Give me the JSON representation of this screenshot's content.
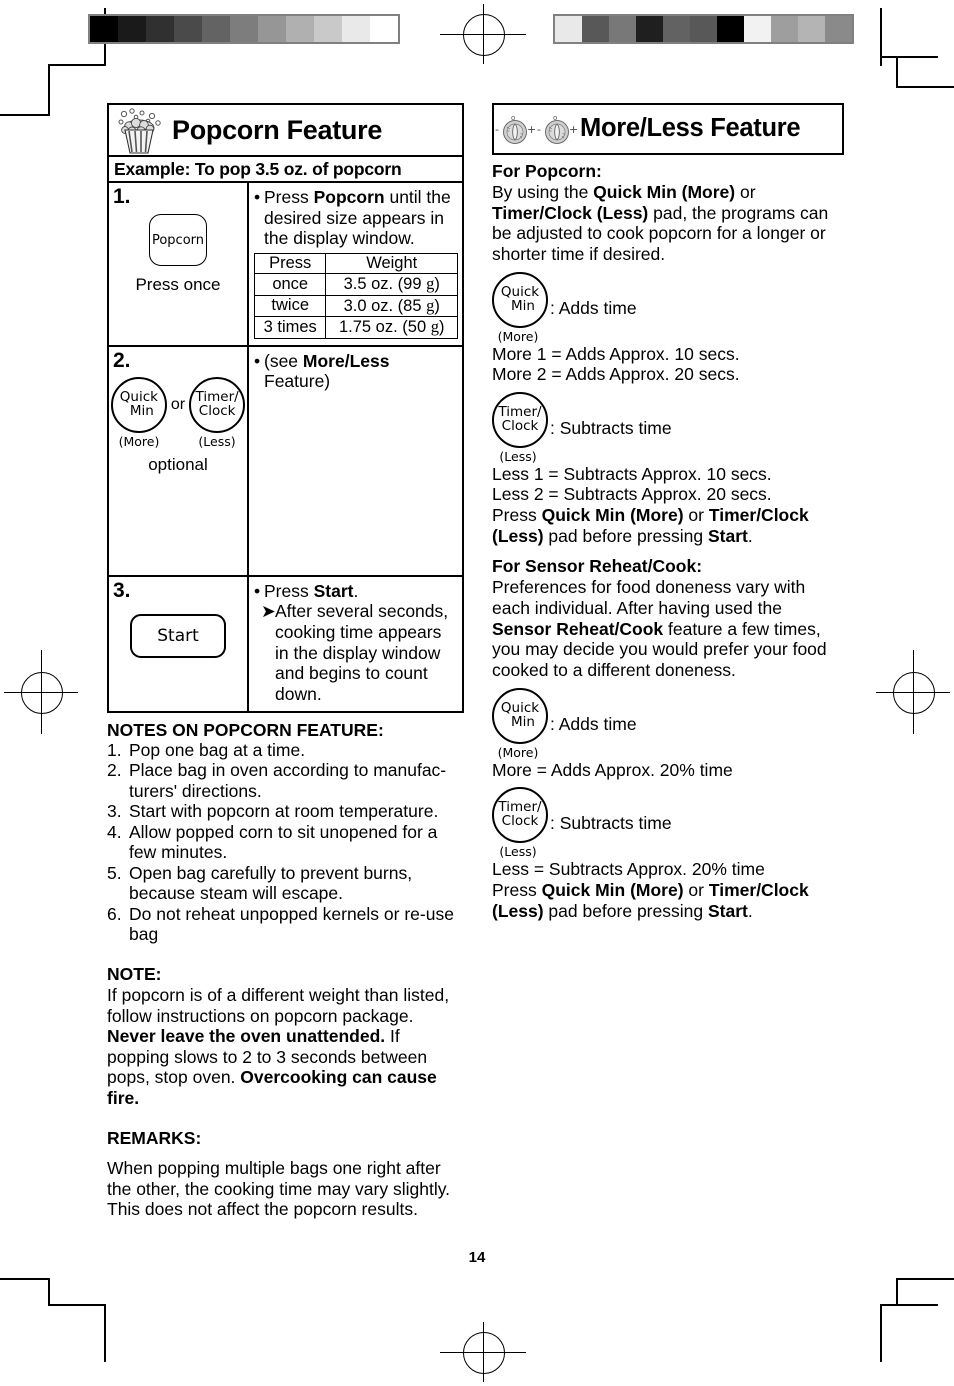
{
  "page": {
    "number": "14"
  },
  "marks": {
    "grey_bar_left": [
      "#000000",
      "#1a1a1a",
      "#303030",
      "#4a4a4a",
      "#636363",
      "#7d7d7d",
      "#969696",
      "#b0b0b0",
      "#c9c9c9",
      "#e9e9e9",
      "#ffffff"
    ],
    "grey_bar_right": [
      "#e9e9e9",
      "#585858",
      "#787878",
      "#1f1f1f",
      "#626262",
      "#585858",
      "#000000",
      "#f2f2f2",
      "#9e9e9e",
      "#b4b4b4",
      "#8a8a8a"
    ]
  },
  "left": {
    "header": {
      "title": "Popcorn Feature",
      "icon": "popcorn-bucket-icon"
    },
    "example_bar": "Example: To pop 3.5 oz. of popcorn",
    "steps": [
      {
        "num": "1.",
        "pad_label": "Popcorn",
        "caption": "Press once",
        "instruction_pre": "Press ",
        "instruction_bold": "Popcorn",
        "instruction_post": " until the desired size appears in the display window.",
        "table": {
          "headers": [
            "Press",
            "Weight"
          ],
          "rows": [
            {
              "press": "once",
              "weight": "3.5 oz. (99 g)"
            },
            {
              "press": "twice",
              "weight": "3.0 oz. (85 g)"
            },
            {
              "press": "3 times",
              "weight": "1.75 oz. (50 g)"
            }
          ]
        }
      },
      {
        "num": "2.",
        "circle_a": {
          "line1": "Quick",
          "line2": "Min",
          "sub": "(More)"
        },
        "or": "or",
        "circle_b": {
          "line1": "Timer/",
          "line2": "Clock",
          "sub": "(Less)"
        },
        "caption": "optional",
        "instruction_pre": "(see ",
        "instruction_bold": "More/Less",
        "instruction_post": " Feature)"
      },
      {
        "num": "3.",
        "pad_label": "Start",
        "instruction_pre": "Press ",
        "instruction_bold": "Start",
        "instruction_post": ".",
        "sub_instruction": "After several seconds, cooking time appears in the display window and begins to count down."
      }
    ],
    "notes_title": "NOTES ON POPCORN FEATURE:",
    "notes": [
      {
        "n": "1.",
        "t": "Pop one bag at a time."
      },
      {
        "n": "2.",
        "t": "Place bag in oven according to manufac-turers' directions."
      },
      {
        "n": "3.",
        "t": "Start with popcorn at room temperature."
      },
      {
        "n": "4.",
        "t": "Allow popped corn to sit unopened for a few minutes."
      },
      {
        "n": "5.",
        "t": "Open bag carefully to prevent burns, because steam will escape."
      },
      {
        "n": "6.",
        "t": "Do not reheat unpopped kernels or re-use bag"
      }
    ],
    "note_title": "NOTE:",
    "note_p1": "If popcorn is of a different weight than listed, follow instructions on popcorn package. ",
    "note_b1": "Never leave the oven unattended.",
    "note_p2": " If popping slows to 2 to 3 seconds between pops, stop oven. ",
    "note_b2": "Overcooking can cause fire.",
    "remarks_title": "REMARKS:",
    "remarks_body": "When popping multiple bags one right after the other, the cooking time may vary slightly. This does not affect the popcorn results."
  },
  "right": {
    "header": {
      "title": "More/Less Feature",
      "icon_a": "dial-knob-minus-plus-icon",
      "icon_b": "dial-knob-minus-plus-icon"
    },
    "popcorn_title": "For Popcorn:",
    "popcorn_p_pre": "By using the ",
    "popcorn_p_b1": "Quick Min (More)",
    "popcorn_p_mid": " or ",
    "popcorn_p_b2": "Timer/Clock (Less)",
    "popcorn_p_post": " pad, the programs can be adjusted to cook popcorn for a longer or shorter time if desired.",
    "more_pad": {
      "line1": "Quick",
      "line2": "Min",
      "sub": "(More)",
      "effect": ": Adds time"
    },
    "more_lines": [
      "More 1 = Adds Approx. 10 secs.",
      "More 2 = Adds Approx. 20 secs."
    ],
    "less_pad": {
      "line1": "Timer/",
      "line2": "Clock",
      "sub": "(Less)",
      "effect": ": Subtracts time"
    },
    "less_lines": [
      "Less 1 = Subtracts Approx. 10 secs.",
      "Less 2 = Subtracts Approx. 20 secs."
    ],
    "press_pre": "Press ",
    "press_b1": "Quick Min (More)",
    "press_mid": " or ",
    "press_b2": "Timer/Clock (Less)",
    "press_post": " pad before pressing ",
    "press_b3": "Start",
    "press_end": ".",
    "sensor_title": "For Sensor Reheat/Cook:",
    "sensor_p_pre": "Preferences for food doneness vary with each individual. After having used the ",
    "sensor_p_b": "Sensor Reheat/Cook",
    "sensor_p_post": " feature a few times, you may decide you would prefer your food cooked to a different doneness.",
    "sensor_more_pad": {
      "line1": "Quick",
      "line2": "Min",
      "sub": "(More)",
      "effect": ": Adds time"
    },
    "sensor_more_line": "More = Adds Approx. 20% time",
    "sensor_less_pad": {
      "line1": "Timer/",
      "line2": "Clock",
      "sub": "(Less)",
      "effect": ": Subtracts time"
    },
    "sensor_less_line": "Less = Subtracts Approx. 20% time"
  }
}
